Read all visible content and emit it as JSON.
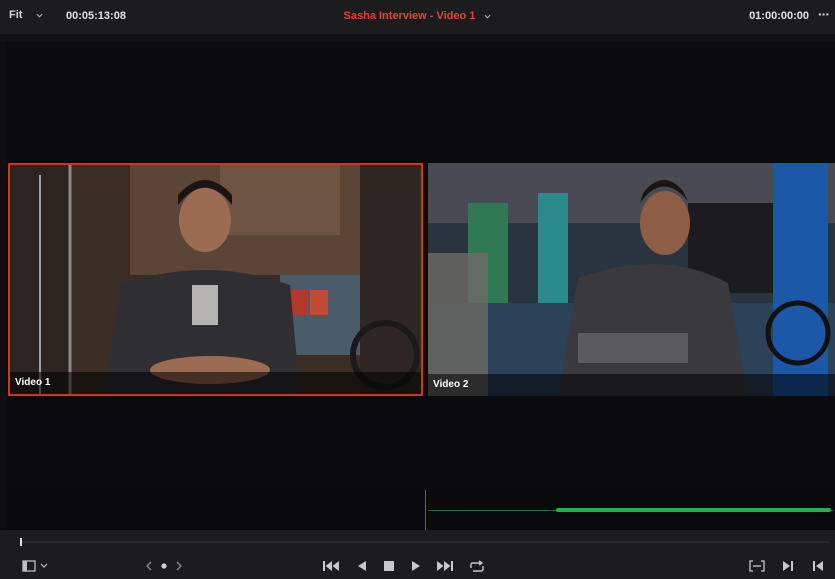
{
  "viewer": {
    "zoom_label": "Fit",
    "source_timecode": "00:05:13:08",
    "title": "Sasha Interview - Video 1",
    "record_timecode": "01:00:00:00",
    "more_label": "···"
  },
  "angles": [
    {
      "label": "Video 1",
      "active": true
    },
    {
      "label": "Video 2",
      "active": false
    }
  ],
  "colors": {
    "accent_red": "#e8413a",
    "active_border": "#d5302b",
    "audio_green": "#23b04d"
  },
  "icons": {
    "viewer_mode": "viewer-mode-icon",
    "jog": "jog-nudge-icon",
    "first_frame": "skip-to-start-icon",
    "reverse": "play-reverse-icon",
    "stop": "stop-icon",
    "play": "play-icon",
    "last_frame": "skip-to-end-icon",
    "loop": "loop-icon",
    "match_frame": "match-frame-icon",
    "next": "next-edit-icon",
    "prev": "prev-edit-icon"
  }
}
